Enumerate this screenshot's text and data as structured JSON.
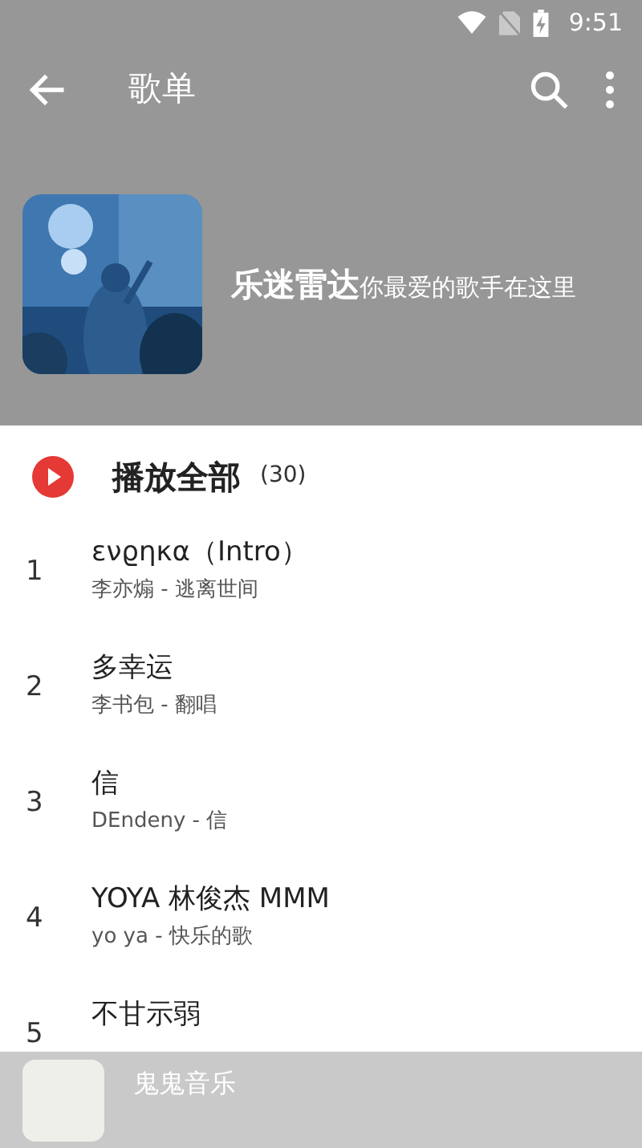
{
  "status_bar": {
    "time": "9:51"
  },
  "toolbar": {
    "title": "歌单"
  },
  "playlist": {
    "name": "乐迷雷达",
    "description": "你最爱的歌手在这里"
  },
  "play_all": {
    "label": "播放全部",
    "count": "(30)"
  },
  "songs": [
    {
      "index": "1",
      "title": "ενϱηκα（Intro）",
      "subtitle": "李亦煽 - 逃离世间"
    },
    {
      "index": "2",
      "title": "多幸运",
      "subtitle": "李书包 - 翻唱"
    },
    {
      "index": "3",
      "title": "信",
      "subtitle": "DEndeny - 信"
    },
    {
      "index": "4",
      "title": "YOYA 林俊杰 MMM",
      "subtitle": "yo ya - 快乐的歌"
    },
    {
      "index": "5",
      "title": "不甘示弱"
    }
  ],
  "mini_player": {
    "title": "鬼鬼音乐"
  }
}
